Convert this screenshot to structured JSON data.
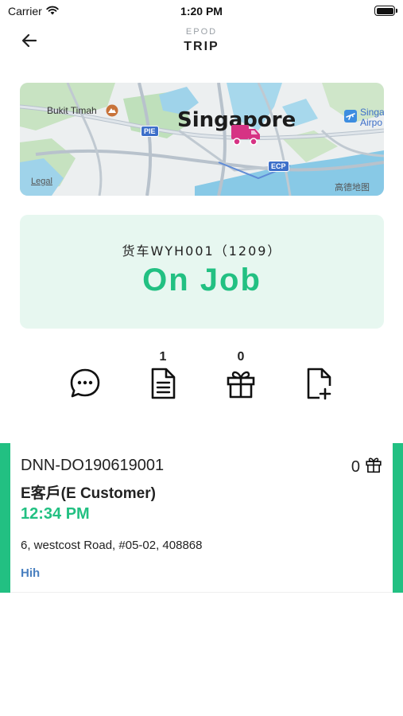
{
  "status_bar": {
    "carrier": "Carrier",
    "time": "1:20 PM"
  },
  "header": {
    "subtitle": "EPOD",
    "title": "TRIP"
  },
  "map": {
    "city_label": "Singapore",
    "place_bukit_timah": "Bukit Timah",
    "place_airport_1": "Singa",
    "place_airport_2": "Airpo",
    "legal": "Legal",
    "attribution": "高德地图",
    "road_pie": "PIE",
    "road_ecp": "ECP"
  },
  "status_card": {
    "vehicle": "货车WYH001（1209）",
    "job_status": "On Job"
  },
  "actions": {
    "chat_count": "",
    "document_count": "1",
    "gift_count": "0",
    "add_document_count": ""
  },
  "delivery": {
    "order_id": "DNN-DO190619001",
    "item_count": "0",
    "customer": "E客戶(E Customer)",
    "time": "12:34 PM",
    "address": "6, westcost Road, #05-02, 408868",
    "note": "Hih"
  },
  "colors": {
    "accent_green": "#22c082",
    "card_bg": "#e7f7f0",
    "truck_magenta": "#d63384",
    "link_blue": "#4a80c0"
  }
}
